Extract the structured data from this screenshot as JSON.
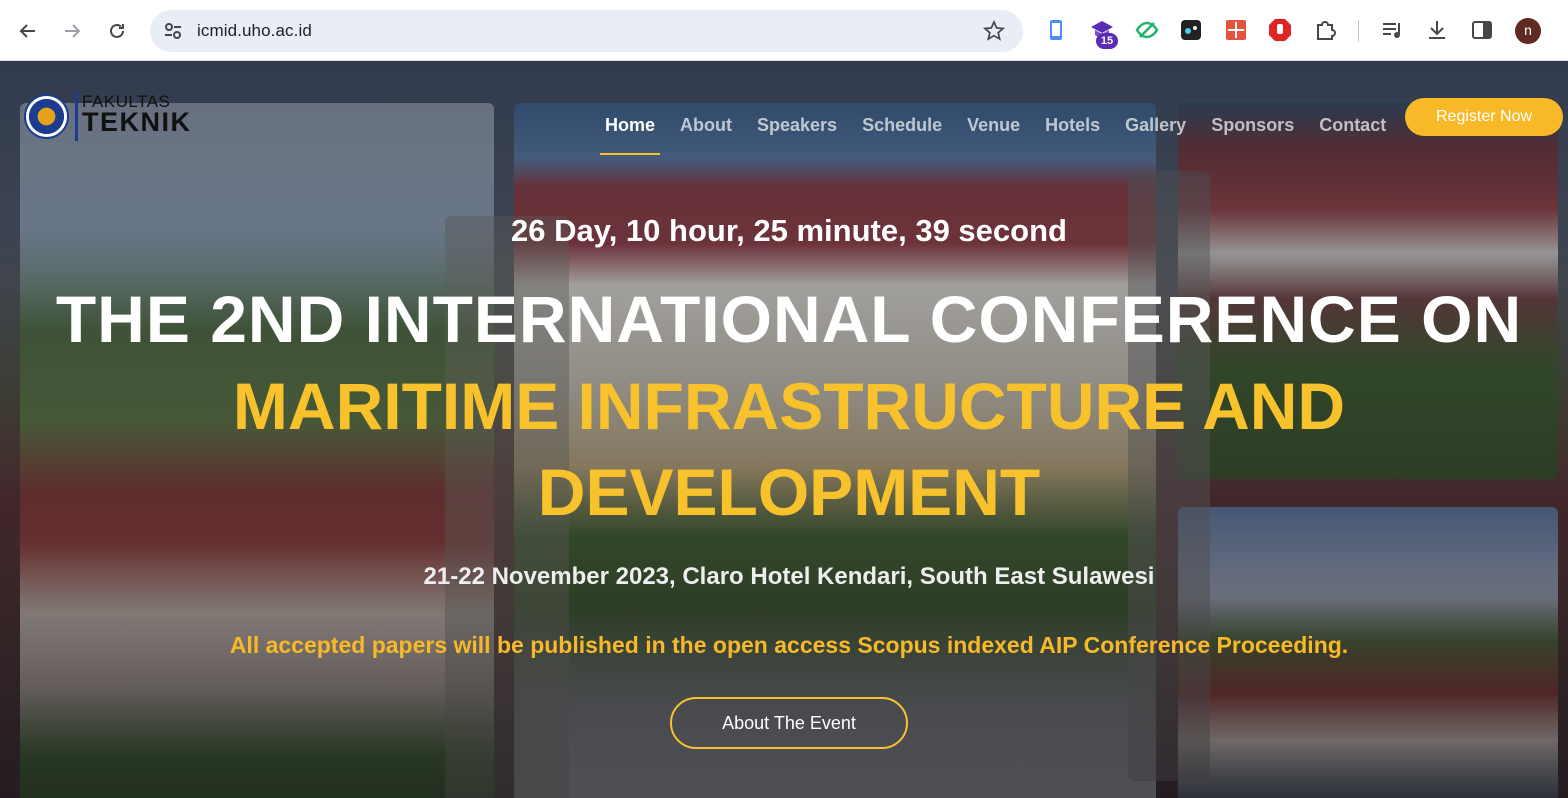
{
  "browser": {
    "url": "icmid.uho.ac.id",
    "extension_badge": "15",
    "profile_initial": "n"
  },
  "logo": {
    "line1": "FAKULTAS",
    "line2": "TEKNIK"
  },
  "nav": {
    "items": [
      "Home",
      "About",
      "Speakers",
      "Schedule",
      "Venue",
      "Hotels",
      "Gallery",
      "Sponsors",
      "Contact"
    ],
    "active": "Home",
    "register_label": "Register Now"
  },
  "hero": {
    "countdown": "26 Day, 10 hour, 25 minute, 39 second",
    "title_line1": "THE 2ND INTERNATIONAL CONFERENCE ON",
    "title_line2": "MARITIME INFRASTRUCTURE AND DEVELOPMENT",
    "dates_venue": "21-22 November 2023, Claro Hotel Kendari, South East Sulawesi",
    "notice": "All accepted papers will be published in the open access Scopus indexed AIP Conference Proceeding.",
    "cta_label": "About The Event"
  },
  "colors": {
    "accent": "#f8c22c",
    "register_bg": "#f8b928",
    "notice": "#f8b928"
  }
}
